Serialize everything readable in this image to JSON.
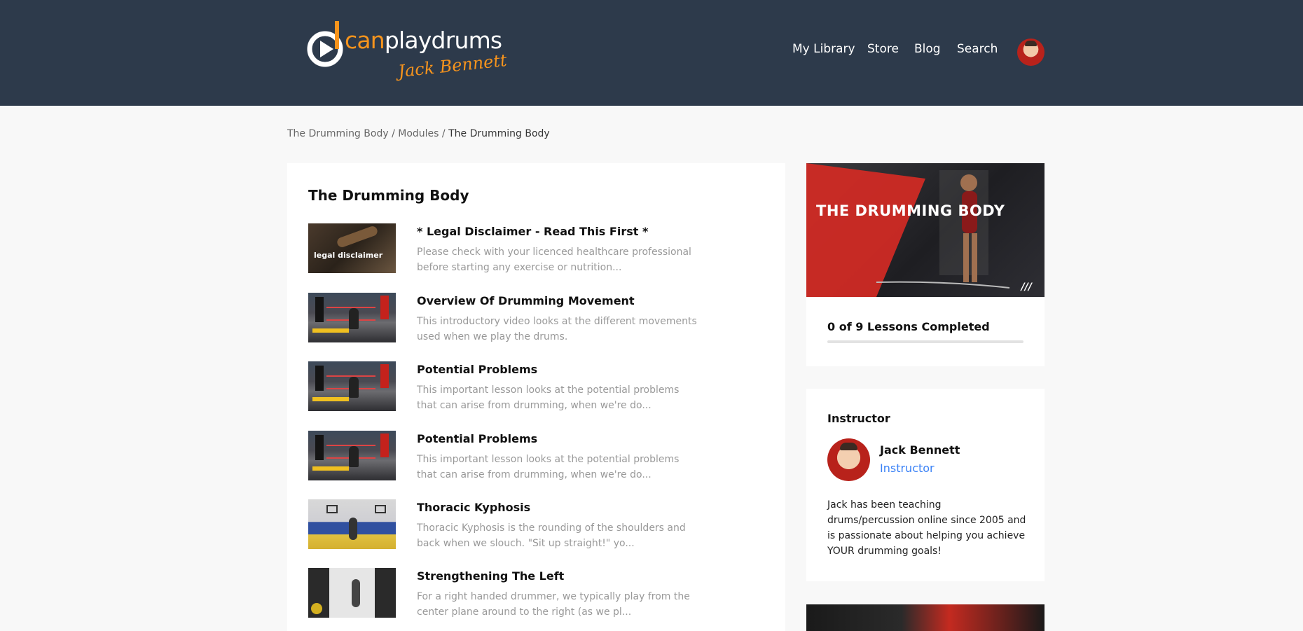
{
  "header": {
    "logo": {
      "brand_prefix": "can",
      "brand_suffix": "playdrums",
      "signature": "Jack Bennett"
    },
    "nav": [
      "My Library",
      "Store",
      "Blog",
      "Search"
    ]
  },
  "breadcrumb": {
    "items": [
      "The Drumming Body",
      "Modules"
    ],
    "separator": "/",
    "current": "The Drumming Body"
  },
  "module": {
    "title": "The Drumming Body",
    "lessons": [
      {
        "title": "* Legal Disclaimer - Read This First *",
        "description": "Please check with your licenced healthcare professional before starting any exercise or nutrition...",
        "thumb_text": "legal disclaimer"
      },
      {
        "title": "Overview Of Drumming Movement",
        "description": "This introductory video looks at the different movements used when we play the drums."
      },
      {
        "title": "Potential Problems",
        "description": "This important lesson looks at the potential problems that can arise from drumming, when we're do..."
      },
      {
        "title": "Potential Problems",
        "description": "This important lesson looks at the potential problems that can arise from drumming, when we're do..."
      },
      {
        "title": "Thoracic Kyphosis",
        "description": "Thoracic Kyphosis is the rounding of the shoulders and back when we slouch. \"Sit up straight!\" yo..."
      },
      {
        "title": "Strengthening The Left",
        "description": "For a right handed drummer, we typically play from the center plane around to the right (as we pl..."
      }
    ]
  },
  "course_card": {
    "hero_title": "THE DRUMMING BODY",
    "hero_mark": "///",
    "progress_text": "0 of 9 Lessons Completed",
    "progress_fraction": 0,
    "accent_color": "#3b82f6"
  },
  "instructor": {
    "heading": "Instructor",
    "name": "Jack Bennett",
    "role": "Instructor",
    "bio": "Jack has been teaching drums/percussion online since 2005 and is passionate about helping you achieve YOUR drumming goals!"
  },
  "colors": {
    "header_bg": "#2d3a4b",
    "brand_orange": "#f7941d",
    "hero_red": "#d42a24",
    "link_blue": "#3b82f6"
  }
}
